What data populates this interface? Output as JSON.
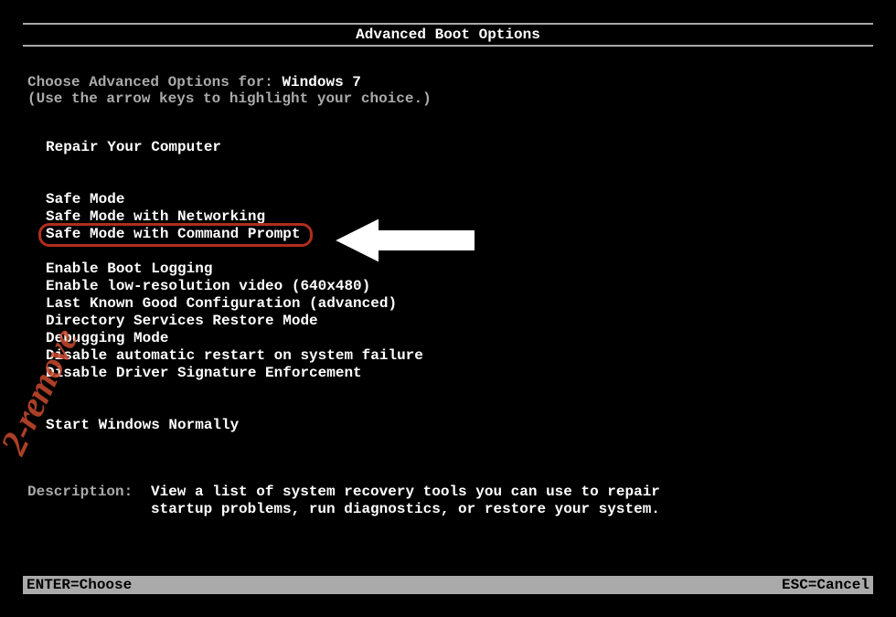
{
  "title": "Advanced Boot Options",
  "intro": {
    "prefix": "Choose Advanced Options for: ",
    "os": "Windows 7",
    "help": "(Use the arrow keys to highlight your choice.)"
  },
  "groups": {
    "repair": "Repair Your Computer",
    "safe": [
      "Safe Mode",
      "Safe Mode with Networking",
      "Safe Mode with Command Prompt"
    ],
    "advanced": [
      "Enable Boot Logging",
      "Enable low-resolution video (640x480)",
      "Last Known Good Configuration (advanced)",
      "Directory Services Restore Mode",
      "Debugging Mode",
      "Disable automatic restart on system failure",
      "Disable Driver Signature Enforcement"
    ],
    "normal": "Start Windows Normally"
  },
  "description": {
    "label": "Description:",
    "text1": "View a list of system recovery tools you can use to repair",
    "text2": "startup problems, run diagnostics, or restore your system."
  },
  "footer": {
    "enter": "ENTER=Choose",
    "esc": "ESC=Cancel"
  },
  "watermark": "2-remove"
}
